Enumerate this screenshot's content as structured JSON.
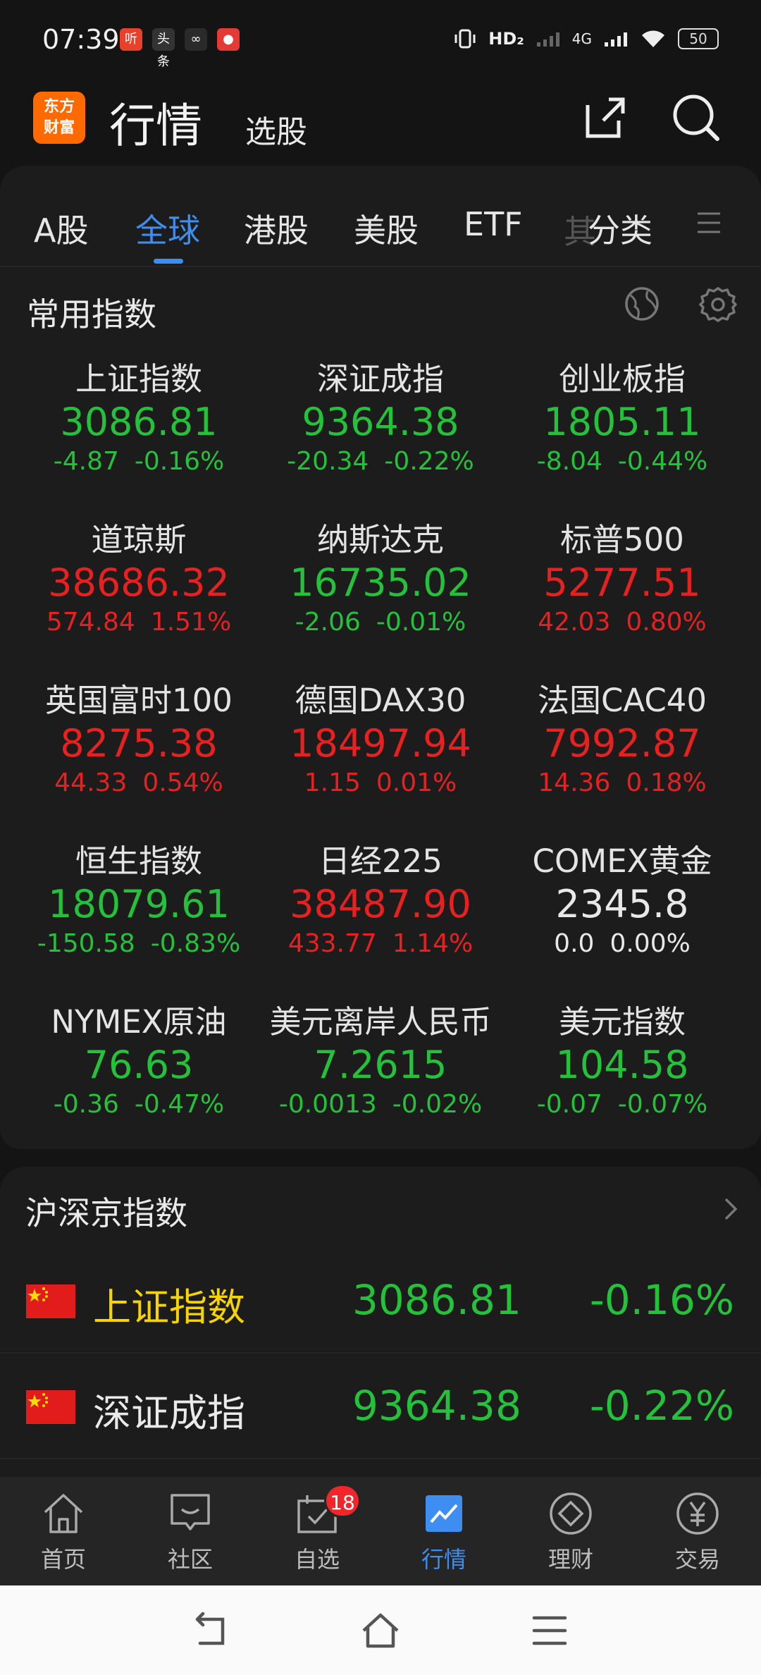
{
  "status_bar": {
    "time": "07:39",
    "apps": [
      {
        "name": "ting-app-icon",
        "text": "听",
        "color": "#e8402a"
      },
      {
        "name": "toutiao-app-icon",
        "text": "头条",
        "color": "#333333"
      },
      {
        "name": "link-app-icon",
        "text": "∞",
        "color": "#2a2a2a"
      },
      {
        "name": "video-app-icon",
        "text": "●",
        "color": "#e53935"
      }
    ],
    "hd_label": "HD₂",
    "network": "4G",
    "battery": "50"
  },
  "header": {
    "logo_line1": "东方",
    "logo_line2": "财富",
    "title": "行情",
    "subtitle": "选股"
  },
  "tabs": [
    {
      "label": "A股",
      "active": false
    },
    {
      "label": "全球",
      "active": true
    },
    {
      "label": "港股",
      "active": false
    },
    {
      "label": "美股",
      "active": false
    },
    {
      "label": "ETF",
      "active": false
    },
    {
      "label": "分类",
      "active": false
    }
  ],
  "tabs_partial": "其",
  "common_indices": {
    "title": "常用指数",
    "items": [
      {
        "name": "上证指数",
        "price": "3086.81",
        "change": "-4.87",
        "pct": "-0.16%",
        "trend": "down"
      },
      {
        "name": "深证成指",
        "price": "9364.38",
        "change": "-20.34",
        "pct": "-0.22%",
        "trend": "down"
      },
      {
        "name": "创业板指",
        "price": "1805.11",
        "change": "-8.04",
        "pct": "-0.44%",
        "trend": "down"
      },
      {
        "name": "道琼斯",
        "price": "38686.32",
        "change": "574.84",
        "pct": "1.51%",
        "trend": "up"
      },
      {
        "name": "纳斯达克",
        "price": "16735.02",
        "change": "-2.06",
        "pct": "-0.01%",
        "trend": "down"
      },
      {
        "name": "标普500",
        "price": "5277.51",
        "change": "42.03",
        "pct": "0.80%",
        "trend": "up"
      },
      {
        "name": "英国富时100",
        "price": "8275.38",
        "change": "44.33",
        "pct": "0.54%",
        "trend": "up"
      },
      {
        "name": "德国DAX30",
        "price": "18497.94",
        "change": "1.15",
        "pct": "0.01%",
        "trend": "up"
      },
      {
        "name": "法国CAC40",
        "price": "7992.87",
        "change": "14.36",
        "pct": "0.18%",
        "trend": "up"
      },
      {
        "name": "恒生指数",
        "price": "18079.61",
        "change": "-150.58",
        "pct": "-0.83%",
        "trend": "down"
      },
      {
        "name": "日经225",
        "price": "38487.90",
        "change": "433.77",
        "pct": "1.14%",
        "trend": "up"
      },
      {
        "name": "COMEX黄金",
        "price": "2345.8",
        "change": "0.0",
        "pct": "0.00%",
        "trend": "flat"
      },
      {
        "name": "NYMEX原油",
        "price": "76.63",
        "change": "-0.36",
        "pct": "-0.47%",
        "trend": "down"
      },
      {
        "name": "美元离岸人民币",
        "price": "7.2615",
        "change": "-0.0013",
        "pct": "-0.02%",
        "trend": "down"
      },
      {
        "name": "美元指数",
        "price": "104.58",
        "change": "-0.07",
        "pct": "-0.07%",
        "trend": "down"
      }
    ]
  },
  "hs_indices": {
    "title": "沪深京指数",
    "rows": [
      {
        "name": "上证指数",
        "price": "3086.81",
        "pct": "-0.16%",
        "name_color": "#f5d400"
      },
      {
        "name": "深证成指",
        "price": "9364.38",
        "pct": "-0.22%",
        "name_color": "#eaeaea"
      }
    ]
  },
  "bottom_nav": [
    {
      "label": "首页",
      "icon": "home-icon",
      "active": false
    },
    {
      "label": "社区",
      "icon": "community-icon",
      "active": false
    },
    {
      "label": "自选",
      "icon": "watchlist-icon",
      "active": false,
      "badge": "18"
    },
    {
      "label": "行情",
      "icon": "market-icon",
      "active": true
    },
    {
      "label": "理财",
      "icon": "wealth-icon",
      "active": false
    },
    {
      "label": "交易",
      "icon": "trade-icon",
      "active": false
    }
  ],
  "colors": {
    "up": "#e82020",
    "down": "#24c23a",
    "accent": "#3d8ef0",
    "background": "#141414",
    "panel": "#1c1c1c"
  }
}
